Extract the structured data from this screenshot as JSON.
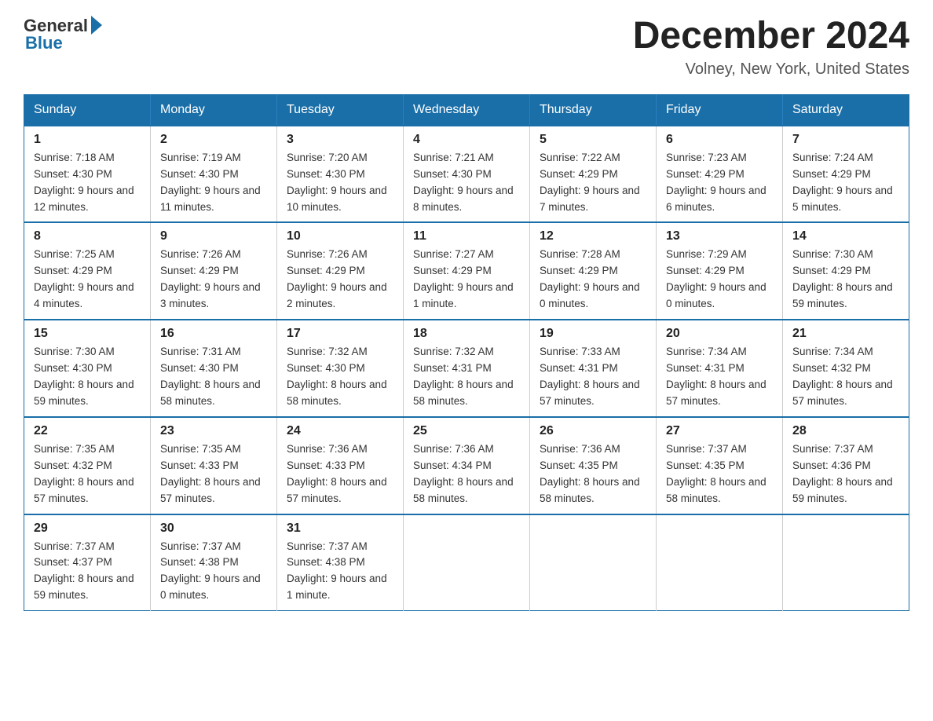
{
  "header": {
    "logo_general": "General",
    "logo_blue": "Blue",
    "month_title": "December 2024",
    "location": "Volney, New York, United States"
  },
  "weekdays": [
    "Sunday",
    "Monday",
    "Tuesday",
    "Wednesday",
    "Thursday",
    "Friday",
    "Saturday"
  ],
  "weeks": [
    [
      {
        "day": "1",
        "sunrise": "7:18 AM",
        "sunset": "4:30 PM",
        "daylight": "9 hours and 12 minutes."
      },
      {
        "day": "2",
        "sunrise": "7:19 AM",
        "sunset": "4:30 PM",
        "daylight": "9 hours and 11 minutes."
      },
      {
        "day": "3",
        "sunrise": "7:20 AM",
        "sunset": "4:30 PM",
        "daylight": "9 hours and 10 minutes."
      },
      {
        "day": "4",
        "sunrise": "7:21 AM",
        "sunset": "4:30 PM",
        "daylight": "9 hours and 8 minutes."
      },
      {
        "day": "5",
        "sunrise": "7:22 AM",
        "sunset": "4:29 PM",
        "daylight": "9 hours and 7 minutes."
      },
      {
        "day": "6",
        "sunrise": "7:23 AM",
        "sunset": "4:29 PM",
        "daylight": "9 hours and 6 minutes."
      },
      {
        "day": "7",
        "sunrise": "7:24 AM",
        "sunset": "4:29 PM",
        "daylight": "9 hours and 5 minutes."
      }
    ],
    [
      {
        "day": "8",
        "sunrise": "7:25 AM",
        "sunset": "4:29 PM",
        "daylight": "9 hours and 4 minutes."
      },
      {
        "day": "9",
        "sunrise": "7:26 AM",
        "sunset": "4:29 PM",
        "daylight": "9 hours and 3 minutes."
      },
      {
        "day": "10",
        "sunrise": "7:26 AM",
        "sunset": "4:29 PM",
        "daylight": "9 hours and 2 minutes."
      },
      {
        "day": "11",
        "sunrise": "7:27 AM",
        "sunset": "4:29 PM",
        "daylight": "9 hours and 1 minute."
      },
      {
        "day": "12",
        "sunrise": "7:28 AM",
        "sunset": "4:29 PM",
        "daylight": "9 hours and 0 minutes."
      },
      {
        "day": "13",
        "sunrise": "7:29 AM",
        "sunset": "4:29 PM",
        "daylight": "9 hours and 0 minutes."
      },
      {
        "day": "14",
        "sunrise": "7:30 AM",
        "sunset": "4:29 PM",
        "daylight": "8 hours and 59 minutes."
      }
    ],
    [
      {
        "day": "15",
        "sunrise": "7:30 AM",
        "sunset": "4:30 PM",
        "daylight": "8 hours and 59 minutes."
      },
      {
        "day": "16",
        "sunrise": "7:31 AM",
        "sunset": "4:30 PM",
        "daylight": "8 hours and 58 minutes."
      },
      {
        "day": "17",
        "sunrise": "7:32 AM",
        "sunset": "4:30 PM",
        "daylight": "8 hours and 58 minutes."
      },
      {
        "day": "18",
        "sunrise": "7:32 AM",
        "sunset": "4:31 PM",
        "daylight": "8 hours and 58 minutes."
      },
      {
        "day": "19",
        "sunrise": "7:33 AM",
        "sunset": "4:31 PM",
        "daylight": "8 hours and 57 minutes."
      },
      {
        "day": "20",
        "sunrise": "7:34 AM",
        "sunset": "4:31 PM",
        "daylight": "8 hours and 57 minutes."
      },
      {
        "day": "21",
        "sunrise": "7:34 AM",
        "sunset": "4:32 PM",
        "daylight": "8 hours and 57 minutes."
      }
    ],
    [
      {
        "day": "22",
        "sunrise": "7:35 AM",
        "sunset": "4:32 PM",
        "daylight": "8 hours and 57 minutes."
      },
      {
        "day": "23",
        "sunrise": "7:35 AM",
        "sunset": "4:33 PM",
        "daylight": "8 hours and 57 minutes."
      },
      {
        "day": "24",
        "sunrise": "7:36 AM",
        "sunset": "4:33 PM",
        "daylight": "8 hours and 57 minutes."
      },
      {
        "day": "25",
        "sunrise": "7:36 AM",
        "sunset": "4:34 PM",
        "daylight": "8 hours and 58 minutes."
      },
      {
        "day": "26",
        "sunrise": "7:36 AM",
        "sunset": "4:35 PM",
        "daylight": "8 hours and 58 minutes."
      },
      {
        "day": "27",
        "sunrise": "7:37 AM",
        "sunset": "4:35 PM",
        "daylight": "8 hours and 58 minutes."
      },
      {
        "day": "28",
        "sunrise": "7:37 AM",
        "sunset": "4:36 PM",
        "daylight": "8 hours and 59 minutes."
      }
    ],
    [
      {
        "day": "29",
        "sunrise": "7:37 AM",
        "sunset": "4:37 PM",
        "daylight": "8 hours and 59 minutes."
      },
      {
        "day": "30",
        "sunrise": "7:37 AM",
        "sunset": "4:38 PM",
        "daylight": "9 hours and 0 minutes."
      },
      {
        "day": "31",
        "sunrise": "7:37 AM",
        "sunset": "4:38 PM",
        "daylight": "9 hours and 1 minute."
      },
      null,
      null,
      null,
      null
    ]
  ]
}
